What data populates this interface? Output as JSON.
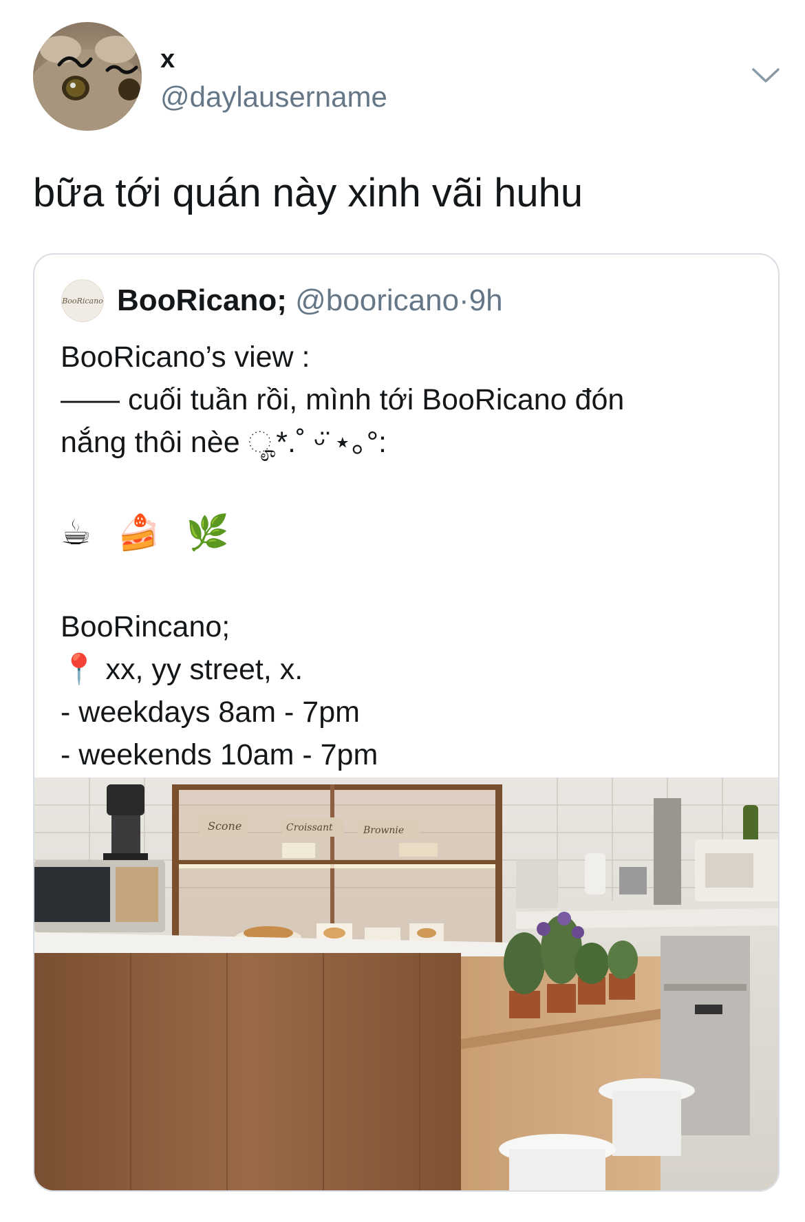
{
  "author": {
    "display_name": "x",
    "handle": "@daylausername",
    "avatar_icon": "cat-face-avatar"
  },
  "tweet": {
    "text": "bữa tới quán này xinh vãi huhu",
    "menu_icon": "chevron-down-icon"
  },
  "quoted": {
    "avatar_label": "BooRicano",
    "name": "BooRicano;",
    "handle": "@booricano",
    "separator": "·",
    "time": "9h",
    "lines": [
      "BooRicano’s view :",
      " —— cuối tuần rồi, mình tới BooRicano đón",
      "nắng thôi nèe ೄ*.˚ ᵕ̈ ⋆｡°:",
      "",
      "☕ 🍰 🌿",
      "",
      "BooRincano;",
      "📍 xx, yy street, x.",
      "- weekdays 8am - 7pm",
      "- weekends 10am - 7pm"
    ],
    "photo_labels": {
      "sign_1": "Scone",
      "sign_2": "Croissant",
      "sign_3": "Brownie"
    }
  },
  "colors": {
    "text": "#14171a",
    "secondary": "#657786",
    "border": "#d8dee3",
    "wood": "#8a5c3c"
  }
}
